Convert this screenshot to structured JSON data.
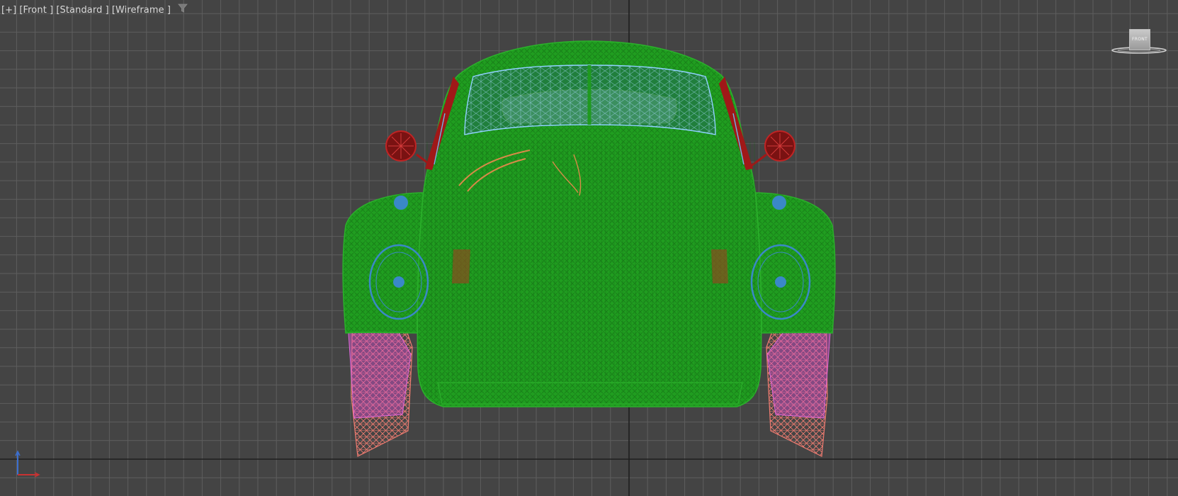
{
  "viewport": {
    "labels": {
      "plus": "[+]",
      "view": "[Front ]",
      "shading": "[Standard ]",
      "display_mode": "[Wireframe ]"
    },
    "filter_icon": "filter-funnel-icon",
    "background_color": "#444444",
    "grid_color": "#5e5e5e",
    "home_grid_axis_color": "#1e1e1e"
  },
  "viewcube": {
    "face_label": "FRONT"
  },
  "model": {
    "description_icon": "car-wireframe",
    "colors": {
      "body": "#1f9a1f",
      "glass": "#6fb7e6",
      "mirrors": "#a01818",
      "lights": "#3a88c8",
      "tires": "#ee7b70",
      "rims": "#d34fce",
      "interior": "#d88a48"
    }
  },
  "axis_tripod": {
    "icon": "axis-tripod-icon",
    "colors": {
      "y": "#3b6fd0",
      "x": "#c83232"
    }
  }
}
